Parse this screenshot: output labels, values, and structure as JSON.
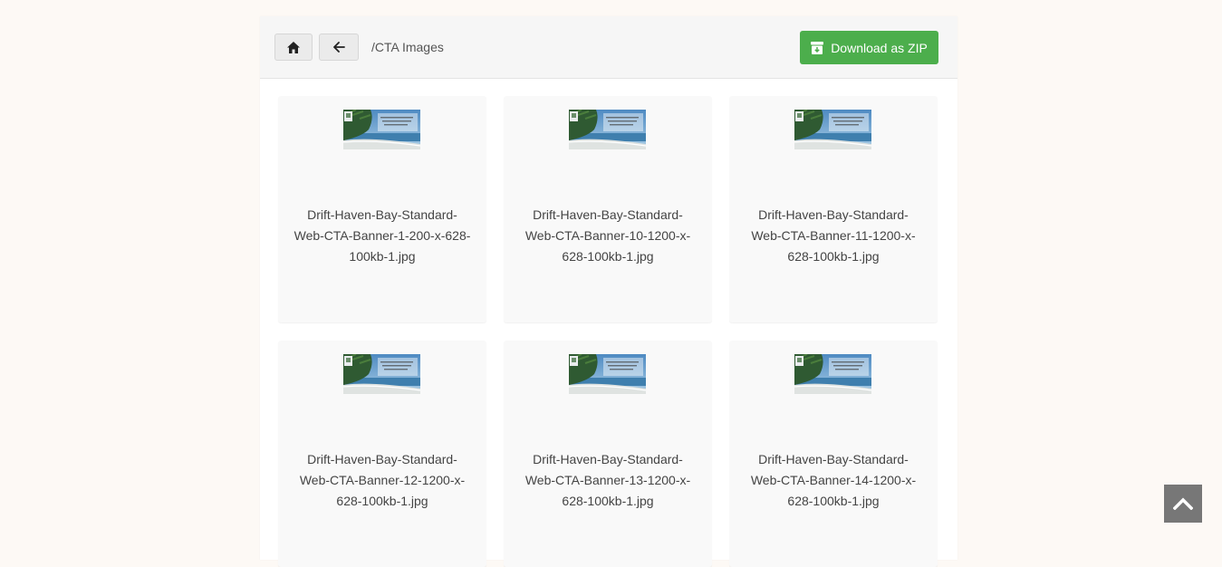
{
  "toolbar": {
    "home_icon": "home-icon",
    "back_icon": "arrow-left-icon",
    "path": "/CTA Images",
    "download_label": "Download as ZIP",
    "download_icon": "archive-download-icon",
    "download_color": "#4cae4c"
  },
  "files": [
    {
      "name": "Drift-Haven-Bay-Standard-Web-CTA-Banner-1-200-x-628-100kb-1.jpg",
      "lines": [
        "Drift-Haven-Bay-Standard-",
        "Web-CTA-Banner-1-200-x-628-",
        "100kb-1.jpg"
      ]
    },
    {
      "name": "Drift-Haven-Bay-Standard-Web-CTA-Banner-10-1200-x-628-100kb-1.jpg",
      "lines": [
        "Drift-Haven-Bay-Standard-",
        "Web-CTA-Banner-10-1200-x-",
        "628-100kb-1.jpg"
      ]
    },
    {
      "name": "Drift-Haven-Bay-Standard-Web-CTA-Banner-11-1200-x-628-100kb-1.jpg",
      "lines": [
        "Drift-Haven-Bay-Standard-",
        "Web-CTA-Banner-11-1200-x-",
        "628-100kb-1.jpg"
      ]
    },
    {
      "name": "Drift-Haven-Bay-Standard-Web-CTA-Banner-12-1200-x-628-100kb-1.jpg",
      "lines": [
        "Drift-Haven-Bay-Standard-",
        "Web-CTA-Banner-12-1200-x-",
        "628-100kb-1.jpg"
      ]
    },
    {
      "name": "Drift-Haven-Bay-Standard-Web-CTA-Banner-13-1200-x-628-100kb-1.jpg",
      "lines": [
        "Drift-Haven-Bay-Standard-",
        "Web-CTA-Banner-13-1200-x-",
        "628-100kb-1.jpg"
      ]
    },
    {
      "name": "Drift-Haven-Bay-Standard-Web-CTA-Banner-14-1200-x-628-100kb-1.jpg",
      "lines": [
        "Drift-Haven-Bay-Standard-",
        "Web-CTA-Banner-14-1200-x-",
        "628-100kb-1.jpg"
      ]
    }
  ],
  "scroll_top_icon": "chevron-up-icon"
}
